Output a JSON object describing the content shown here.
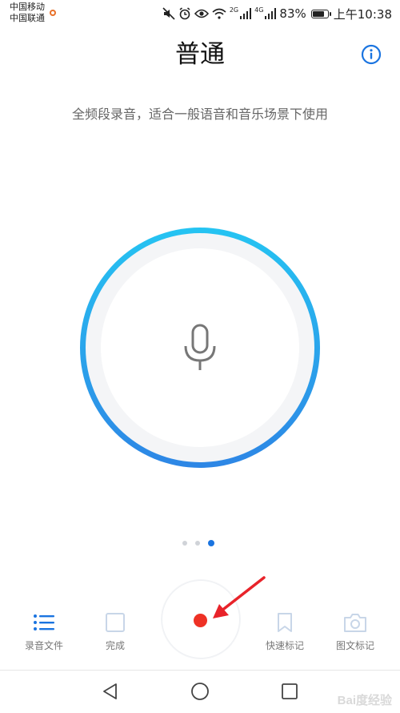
{
  "status_bar": {
    "carrier_1": "中国移动",
    "carrier_2": "中国联通",
    "network_tag_1": "2G",
    "network_tag_2": "4G",
    "battery_percent": "83%",
    "battery_level": 0.83,
    "time": "上午10:38",
    "icons": [
      "mute-icon",
      "alarm-icon",
      "eye-icon",
      "wifi-icon",
      "signal-icon",
      "signal-icon",
      "battery-icon",
      "app-icon"
    ]
  },
  "header": {
    "title": "普通",
    "info_icon": "info-icon"
  },
  "mode_description": "全频段录音，适合一般语音和音乐场景下使用",
  "recorder": {
    "mic_icon": "microphone-icon",
    "accent_color": "#2aa8ec",
    "record_color": "#ee3125"
  },
  "pager": {
    "page_count": 3,
    "active_index": 2
  },
  "toolbar": {
    "files_label": "录音文件",
    "done_label": "完成",
    "quick_mark_label": "快速标记",
    "photo_mark_label": "图文标记"
  },
  "annotation": {
    "arrow_color": "#e8232a"
  },
  "watermark": "Bai度经验"
}
